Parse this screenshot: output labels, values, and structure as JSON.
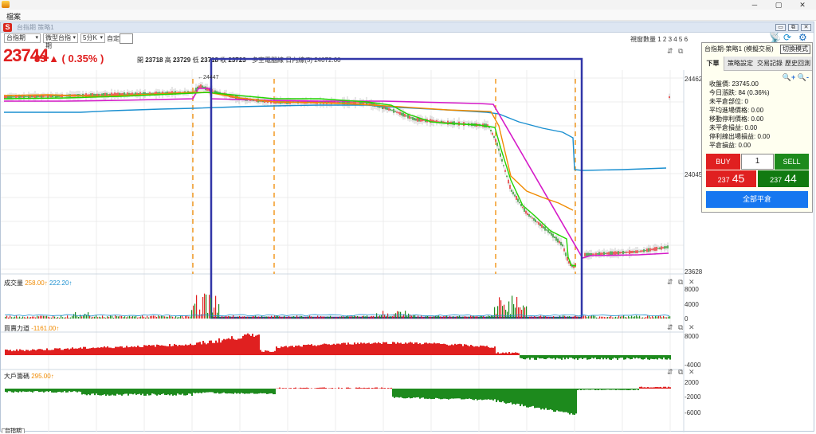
{
  "window": {
    "menu": "檔案",
    "controls": {
      "minimize": "─",
      "maximize": "▢",
      "close": "✕"
    }
  },
  "chart_window": {
    "logo": "S",
    "title": "台指期 策略1",
    "buttons": {
      "minimize": "▭",
      "restore": "⧉",
      "close": "✕"
    }
  },
  "toolbar": {
    "symbol": "台指期",
    "chart_type": "微型台指期",
    "interval": "5分K",
    "custom_label": "自定:",
    "layout_label": "視窗數量 1 2 3 4 5 6"
  },
  "quote": {
    "price": "23744",
    "change": "83 ▲ ( 0.35% )",
    "open_label": "開",
    "open": "23718",
    "high_label": "高",
    "high": "23729",
    "low_label": "低",
    "low": "23718",
    "close_label": "收",
    "close": "23723",
    "strategy_note": "多空電腦線 日內線(5) 24072.00"
  },
  "main_chart": {
    "axis": {
      "top": "24462",
      "mid": "24045",
      "bottom": "23628"
    },
    "peak_label": "←24447",
    "tools": "⇵ ⧉"
  },
  "panes": {
    "volume": {
      "name": "成交量",
      "v1": "258.00↑",
      "v2": "222.20↑",
      "axis": [
        "8000",
        "4000",
        "0"
      ]
    },
    "force": {
      "name": "買賣力道",
      "v1": "-1161.00↑",
      "axis": [
        "8000",
        "-4000"
      ]
    },
    "big": {
      "name": "大戶籌碼",
      "v1": "295.00↑",
      "axis": [
        "2000",
        "-2000",
        "-6000"
      ]
    },
    "tools": "⇵ ⧉ ✕"
  },
  "panel": {
    "title": "台指期-策略1 (模擬交易)",
    "mode_button": "切換模式",
    "tabs": [
      "下單",
      "策略設定",
      "交易記錄",
      "歷史回測"
    ],
    "zoom": "🔍+ 🔍-",
    "info": [
      "收盤價: 23745.00",
      "今日漲跌: 84 (0.36%)",
      "未平倉部位: 0",
      "平均進場價格: 0.00",
      "移動停利價格: 0.00",
      "未平倉損益: 0.00",
      "停利線出場損益: 0.00",
      "平倉損益: 0.00"
    ],
    "buy": "BUY",
    "qty": "1",
    "sell": "SELL",
    "bid_small": "237",
    "bid_big": "45",
    "ask_small": "237",
    "ask_big": "44",
    "close_all": "全部平倉"
  },
  "bottom_tab": "台指期",
  "colors": {
    "up": "#e02020",
    "down": "#1d8a1d",
    "accent": "#1677f0"
  }
}
